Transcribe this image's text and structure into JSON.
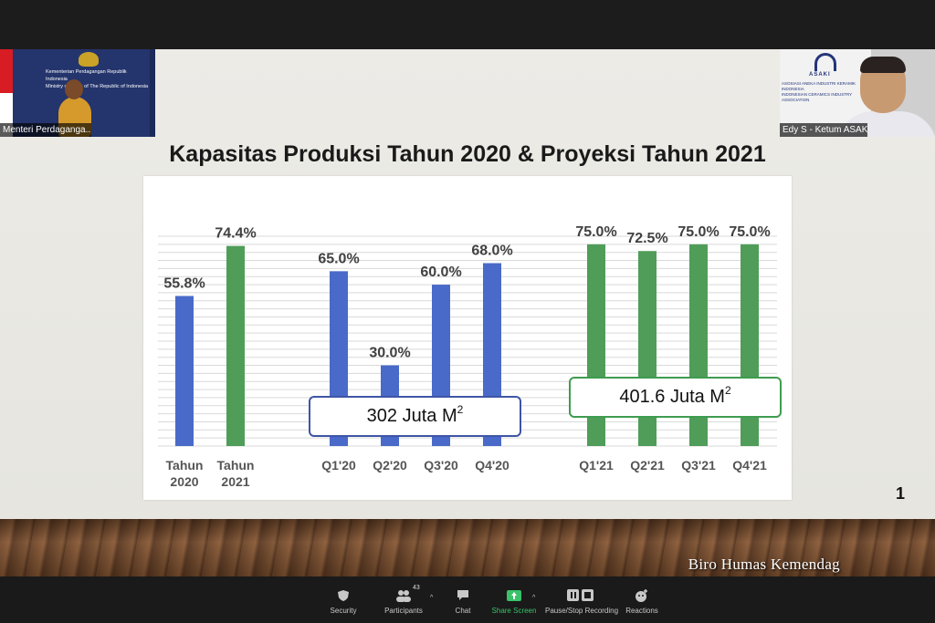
{
  "meeting": {
    "tiles": [
      {
        "name": "Menteri Perdaganga...",
        "banner_text": [
          "Kementerian Perdagangan Republik Indonesia",
          "Ministry of Trade of The Republic of Indonesia"
        ]
      },
      {
        "name": "Edy S - Ketum ASAK...",
        "logo_text": "ASAKI",
        "logo_sub": [
          "ASOSIASI ANEKA INDUSTRI KERAMIK INDONESIA",
          "INDONESIAN CERAMICS INDUSTRY ASSOCIATION"
        ]
      }
    ],
    "watermark": "Biro Humas Kemendag"
  },
  "slide": {
    "title": "Kapasitas Produksi Tahun 2020 & Proyeksi Tahun 2021",
    "page_number": "1",
    "callouts": {
      "c2020": {
        "text": "302 Juta M",
        "sup": "2"
      },
      "c2021": {
        "text": "401.6 Juta M",
        "sup": "2"
      }
    }
  },
  "chart_data": {
    "type": "bar",
    "title": "Kapasitas Produksi Tahun 2020 & Proyeksi Tahun 2021",
    "ylim": [
      0,
      80
    ],
    "grid": true,
    "colors": {
      "blue": "#4a6ac9",
      "green": "#4f9d58"
    },
    "groups": [
      {
        "bars": [
          {
            "label": [
              "Tahun",
              "2020"
            ],
            "value": 55.8,
            "text": "55.8%",
            "color": "blue"
          },
          {
            "label": [
              "Tahun",
              "2021"
            ],
            "value": 74.4,
            "text": "74.4%",
            "color": "green"
          }
        ]
      },
      {
        "bars": [
          {
            "label": [
              "Q1'20"
            ],
            "value": 65.0,
            "text": "65.0%",
            "color": "blue"
          },
          {
            "label": [
              "Q2'20"
            ],
            "value": 30.0,
            "text": "30.0%",
            "color": "blue"
          },
          {
            "label": [
              "Q3'20"
            ],
            "value": 60.0,
            "text": "60.0%",
            "color": "blue"
          },
          {
            "label": [
              "Q4'20"
            ],
            "value": 68.0,
            "text": "68.0%",
            "color": "blue"
          }
        ]
      },
      {
        "bars": [
          {
            "label": [
              "Q1'21"
            ],
            "value": 75.0,
            "text": "75.0%",
            "color": "green"
          },
          {
            "label": [
              "Q2'21"
            ],
            "value": 72.5,
            "text": "72.5%",
            "color": "green"
          },
          {
            "label": [
              "Q3'21"
            ],
            "value": 75.0,
            "text": "75.0%",
            "color": "green"
          },
          {
            "label": [
              "Q4'21"
            ],
            "value": 75.0,
            "text": "75.0%",
            "color": "green"
          }
        ]
      }
    ]
  },
  "toolbar": {
    "security": "Security",
    "participants": "Participants",
    "participants_count": "43",
    "chat": "Chat",
    "share": "Share Screen",
    "record": "Pause/Stop Recording",
    "reactions": "Reactions"
  }
}
